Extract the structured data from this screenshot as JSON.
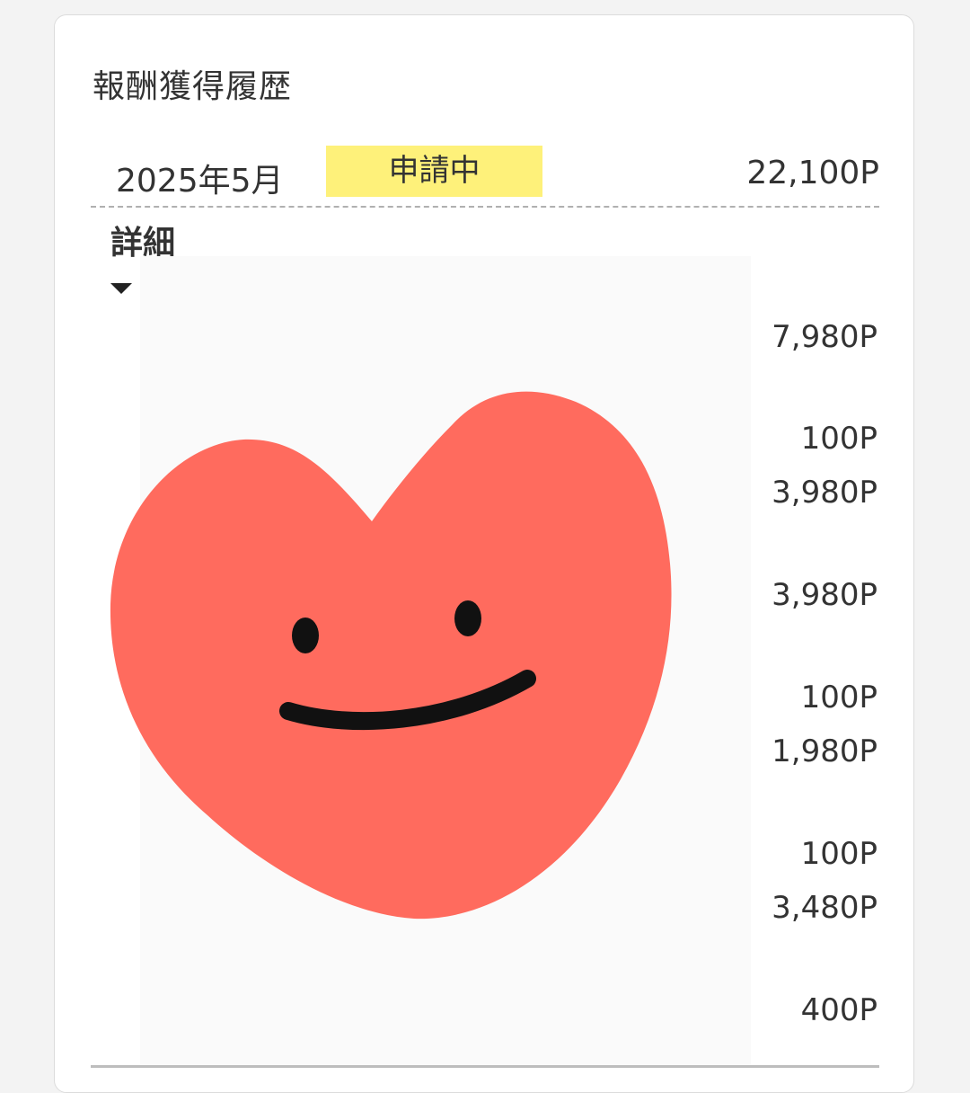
{
  "header": {
    "title": "報酬獲得履歴"
  },
  "summary": {
    "month": "2025年5月",
    "status": "申請中",
    "total": "22,100P"
  },
  "details": {
    "label": "詳細",
    "caret_icon": "caret-down-icon",
    "amounts": [
      "7,980P",
      "100P",
      "3,980P",
      "3,980P",
      "100P",
      "1,980P",
      "100P",
      "3,480P",
      "400P"
    ]
  },
  "illustration": {
    "name": "smiling-heart",
    "fill": "#ff6b5e",
    "face_color": "#111111"
  },
  "colors": {
    "status_badge": "#fef17a",
    "text": "#333333"
  }
}
